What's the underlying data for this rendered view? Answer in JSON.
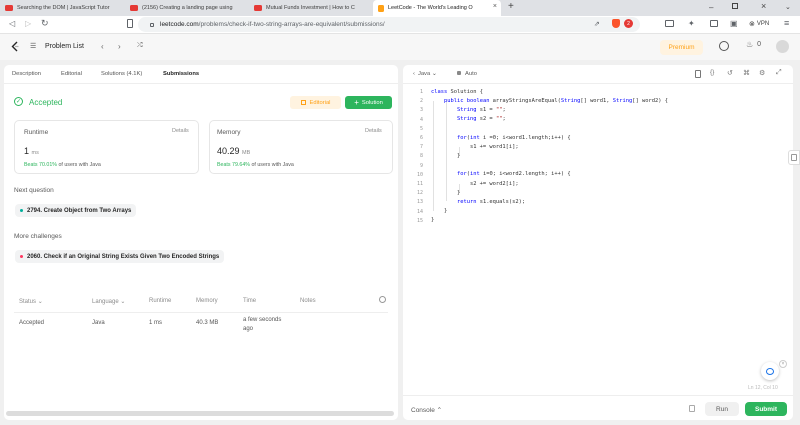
{
  "browser": {
    "tabs": [
      {
        "title": "Searching the DOM | JavaScript Tutor"
      },
      {
        "title": "(2156) Creating a landing page using"
      },
      {
        "title": "Mutual Funds Investment | How to C"
      },
      {
        "title": "LeetCode - The World's Leading O"
      }
    ],
    "url_host": "leetcode.com",
    "url_path": "/problems/check-if-two-string-arrays-are-equivalent/submissions/",
    "vpn_label": "VPN",
    "brave_count": "2"
  },
  "nav": {
    "problem_list": "Problem List",
    "premium": "Premium",
    "streak_count": "0"
  },
  "left": {
    "tabs": [
      "Description",
      "Editorial",
      "Solutions (4.1K)",
      "Submissions"
    ],
    "status": "Accepted",
    "editorial_btn": "Editorial",
    "solution_btn": "Solution",
    "runtime": {
      "label": "Runtime",
      "details": "Details",
      "value": "1",
      "unit": "ms",
      "beats_pct": "Beats 70.01%",
      "beats_rest": " of users with Java"
    },
    "memory": {
      "label": "Memory",
      "details": "Details",
      "value": "40.29",
      "unit": "MB",
      "beats_pct": "Beats 79.64%",
      "beats_rest": " of users with Java"
    },
    "next_question_label": "Next question",
    "next_question": "2794. Create Object from Two Arrays",
    "more_challenges_label": "More challenges",
    "more_challenge": "2060. Check if an Original String Exists Given Two Encoded Strings",
    "table": {
      "headers": [
        "Status",
        "Language",
        "Runtime",
        "Memory",
        "Time",
        "Notes"
      ],
      "row": {
        "status": "Accepted",
        "language": "Java",
        "runtime": "1 ms",
        "memory": "40.3 MB",
        "time_line1": "a few seconds",
        "time_line2": "ago"
      }
    }
  },
  "editor": {
    "language": "Java",
    "format": "Auto",
    "lines": [
      "class Solution {",
      "    public boolean arrayStringsAreEqual(String[] word1, String[] word2) {",
      "        String s1 = \"\";",
      "        String s2 = \"\";",
      "",
      "        for(int i =0; i<word1.length;i++) {",
      "            s1 += word1[i];",
      "        }",
      "",
      "        for(int i=0; i<word2.length; i++) {",
      "            s2 += word2[i];",
      "        }",
      "        return s1.equals(s2);",
      "    }",
      "}"
    ],
    "line_numbers": [
      "1",
      "2",
      "3",
      "4",
      "5",
      "6",
      "7",
      "8",
      "9",
      "10",
      "11",
      "12",
      "13",
      "14",
      "15"
    ],
    "cursor_pos": "Ln 12, Col 10",
    "console": "Console",
    "run": "Run",
    "submit": "Submit"
  },
  "colors": {
    "accent_green": "#2db55d",
    "premium_orange": "#ffa116",
    "brave_orange": "#fb542b"
  }
}
